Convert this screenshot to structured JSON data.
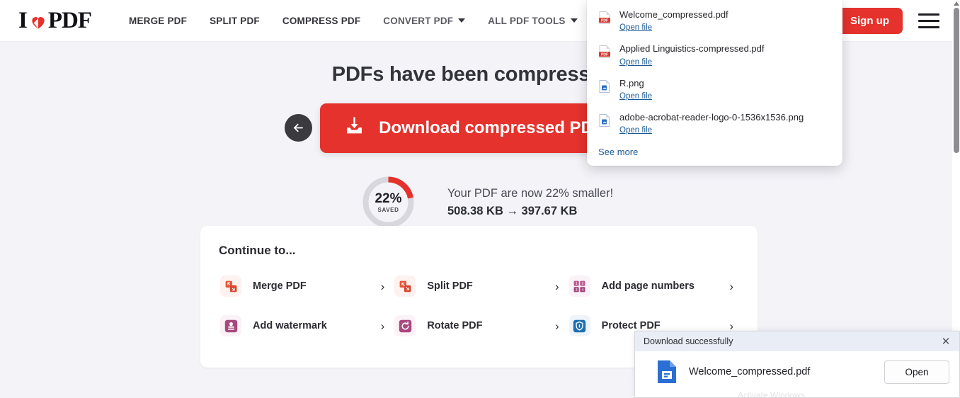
{
  "nav": {
    "logo_i": "I",
    "logo_heart_icon": "heart-icon",
    "logo_pdf": "PDF",
    "links": [
      {
        "label": "MERGE PDF",
        "caret": false
      },
      {
        "label": "SPLIT PDF",
        "caret": false
      },
      {
        "label": "COMPRESS PDF",
        "caret": false
      },
      {
        "label": "CONVERT PDF",
        "caret": true
      },
      {
        "label": "ALL PDF TOOLS",
        "caret": true
      }
    ],
    "signup_label": "Sign up",
    "menu_icon": "hamburger-menu-icon"
  },
  "main": {
    "title": "PDFs have been compressed!",
    "back_icon": "arrow-left-icon",
    "download_icon": "download-icon",
    "download_label": "Download compressed PDFs"
  },
  "savings": {
    "percent_label": "22%",
    "saved_label": "SAVED",
    "percent_value": 22,
    "ring_color": "#e5322d",
    "track_color": "#d7d7dd",
    "line1": "Your PDF are now 22% smaller!",
    "line2": "508.38 KB → 397.67 KB",
    "size_before": "508.38 KB",
    "size_after": "397.67 KB"
  },
  "continue": {
    "title": "Continue to...",
    "chevron": "›",
    "tools": [
      {
        "label": "Merge PDF",
        "icon": "merge-pdf-icon",
        "color": "#e8583c",
        "bg": "#fdf2ef"
      },
      {
        "label": "Split PDF",
        "icon": "split-pdf-icon",
        "color": "#e8583c",
        "bg": "#fdf2ef"
      },
      {
        "label": "Add page numbers",
        "icon": "add-page-numbers-icon",
        "color": "#a8497e",
        "bg": "#faf2f6"
      },
      {
        "label": "Add watermark",
        "icon": "add-watermark-icon",
        "color": "#a8497e",
        "bg": "#faf2f6"
      },
      {
        "label": "Rotate PDF",
        "icon": "rotate-pdf-icon",
        "color": "#a8497e",
        "bg": "#faf2f6"
      },
      {
        "label": "Protect PDF",
        "icon": "protect-pdf-icon",
        "color": "#1f6fb2",
        "bg": "#eef4fa"
      }
    ]
  },
  "downloads_panel": {
    "items": [
      {
        "name": "Welcome_compressed.pdf",
        "open_label": "Open file",
        "icon": "pdf-file-icon"
      },
      {
        "name": "Applied Linguistics-compressed.pdf",
        "open_label": "Open file",
        "icon": "pdf-file-icon"
      },
      {
        "name": "R.png",
        "open_label": "Open file",
        "icon": "image-file-icon"
      },
      {
        "name": "adobe-acrobat-reader-logo-0-1536x1536.png",
        "open_label": "Open file",
        "icon": "image-file-icon"
      }
    ],
    "see_more_label": "See more"
  },
  "notification": {
    "title": "Download successfully",
    "close_icon": "close-icon",
    "file_icon": "pdf-document-icon",
    "filename": "Welcome_compressed.pdf",
    "open_label": "Open",
    "watermark": "Activate Windows"
  },
  "scrollbar": {
    "up_arrow_icon": "scroll-up-arrow-icon"
  }
}
